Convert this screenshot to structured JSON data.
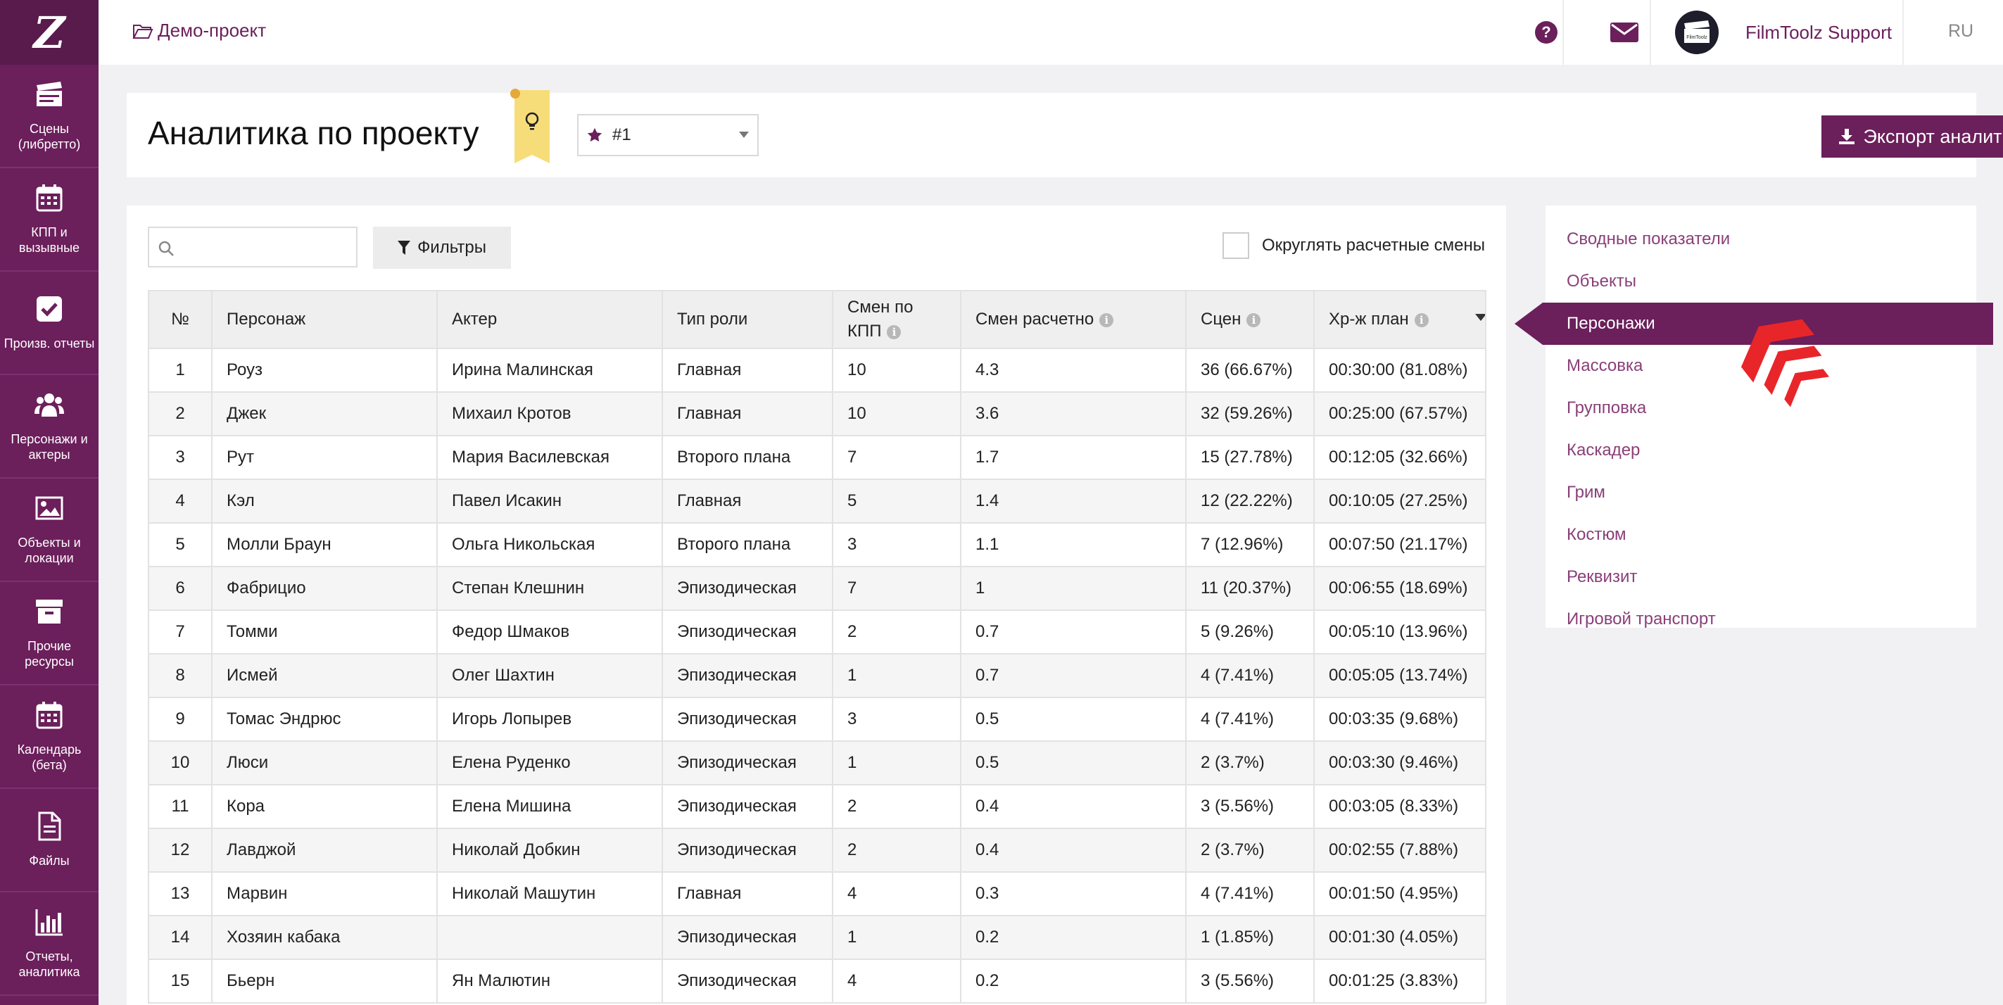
{
  "sidebar": {
    "logo": "Z",
    "items": [
      {
        "label": "Сцены\n(либретто)",
        "icon": "clapperboard-icon"
      },
      {
        "label": "КПП и\nвызывные",
        "icon": "calendar-icon"
      },
      {
        "label": "Произв. отчеты",
        "icon": "checkbox-icon"
      },
      {
        "label": "Персонажи и\nактеры",
        "icon": "users-icon"
      },
      {
        "label": "Объекты и\nлокации",
        "icon": "image-icon"
      },
      {
        "label": "Прочие\nресурсы",
        "icon": "archive-icon"
      },
      {
        "label": "Календарь\n(бета)",
        "icon": "calendar-icon"
      },
      {
        "label": "Файлы",
        "icon": "file-icon"
      },
      {
        "label": "Отчеты,\nаналитика",
        "icon": "bar-chart-icon"
      }
    ]
  },
  "topbar": {
    "breadcrumb": "Демо-проект",
    "user_name": "FilmToolz Support",
    "avatar_text": "FilmToolz",
    "language": "RU",
    "help_icon": "question-circle-icon",
    "mail_icon": "envelope-icon"
  },
  "header": {
    "title": "Аналитика по проекту",
    "version": "#1",
    "export_label": "Экспорт аналитики"
  },
  "toolbar": {
    "search_placeholder": "",
    "filters_label": "Фильтры",
    "round_label": "Округлять расчетные смены"
  },
  "table": {
    "columns": [
      "№",
      "Персонаж",
      "Актер",
      "Тип роли",
      "Смен по КПП",
      "Смен расчетно",
      "Сцен",
      "Хр-ж план"
    ],
    "rows": [
      [
        "1",
        "Роуз",
        "Ирина Малинская",
        "Главная",
        "10",
        "4.3",
        "36 (66.67%)",
        "00:30:00 (81.08%)"
      ],
      [
        "2",
        "Джек",
        "Михаил Кротов",
        "Главная",
        "10",
        "3.6",
        "32 (59.26%)",
        "00:25:00 (67.57%)"
      ],
      [
        "3",
        "Рут",
        "Мария Василевская",
        "Второго плана",
        "7",
        "1.7",
        "15 (27.78%)",
        "00:12:05 (32.66%)"
      ],
      [
        "4",
        "Кэл",
        "Павел Исакин",
        "Главная",
        "5",
        "1.4",
        "12 (22.22%)",
        "00:10:05 (27.25%)"
      ],
      [
        "5",
        "Молли Браун",
        "Ольга Никольская",
        "Второго плана",
        "3",
        "1.1",
        "7 (12.96%)",
        "00:07:50 (21.17%)"
      ],
      [
        "6",
        "Фабрицио",
        "Степан Клешнин",
        "Эпизодическая",
        "7",
        "1",
        "11 (20.37%)",
        "00:06:55 (18.69%)"
      ],
      [
        "7",
        "Томми",
        "Федор Шмаков",
        "Эпизодическая",
        "2",
        "0.7",
        "5 (9.26%)",
        "00:05:10 (13.96%)"
      ],
      [
        "8",
        "Исмей",
        "Олег Шахтин",
        "Эпизодическая",
        "1",
        "0.7",
        "4 (7.41%)",
        "00:05:05 (13.74%)"
      ],
      [
        "9",
        "Томас Эндрюс",
        "Игорь Лопырев",
        "Эпизодическая",
        "3",
        "0.5",
        "4 (7.41%)",
        "00:03:35 (9.68%)"
      ],
      [
        "10",
        "Люси",
        "Елена Руденко",
        "Эпизодическая",
        "1",
        "0.5",
        "2 (3.7%)",
        "00:03:30 (9.46%)"
      ],
      [
        "11",
        "Кора",
        "Елена Мишина",
        "Эпизодическая",
        "2",
        "0.4",
        "3 (5.56%)",
        "00:03:05 (8.33%)"
      ],
      [
        "12",
        "Лавджой",
        "Николай Добкин",
        "Эпизодическая",
        "2",
        "0.4",
        "2 (3.7%)",
        "00:02:55 (7.88%)"
      ],
      [
        "13",
        "Марвин",
        "Николай Машутин",
        "Главная",
        "4",
        "0.3",
        "4 (7.41%)",
        "00:01:50 (4.95%)"
      ],
      [
        "14",
        "Хозяин кабака",
        "",
        "Эпизодическая",
        "1",
        "0.2",
        "1 (1.85%)",
        "00:01:30 (4.05%)"
      ],
      [
        "15",
        "Бьерн",
        "Ян Малютин",
        "Эпизодическая",
        "4",
        "0.2",
        "3 (5.56%)",
        "00:01:25 (3.83%)"
      ]
    ]
  },
  "right_menu": {
    "items": [
      "Сводные показатели",
      "Объекты",
      "Персонажи",
      "Массовка",
      "Групповка",
      "Каскадер",
      "Грим",
      "Костюм",
      "Реквизит",
      "Игровой транспорт"
    ],
    "active_index": 2
  },
  "colors": {
    "brand": "#6b1f5b",
    "pointer": "#e8262a",
    "bulb": "#f7dd7a"
  }
}
